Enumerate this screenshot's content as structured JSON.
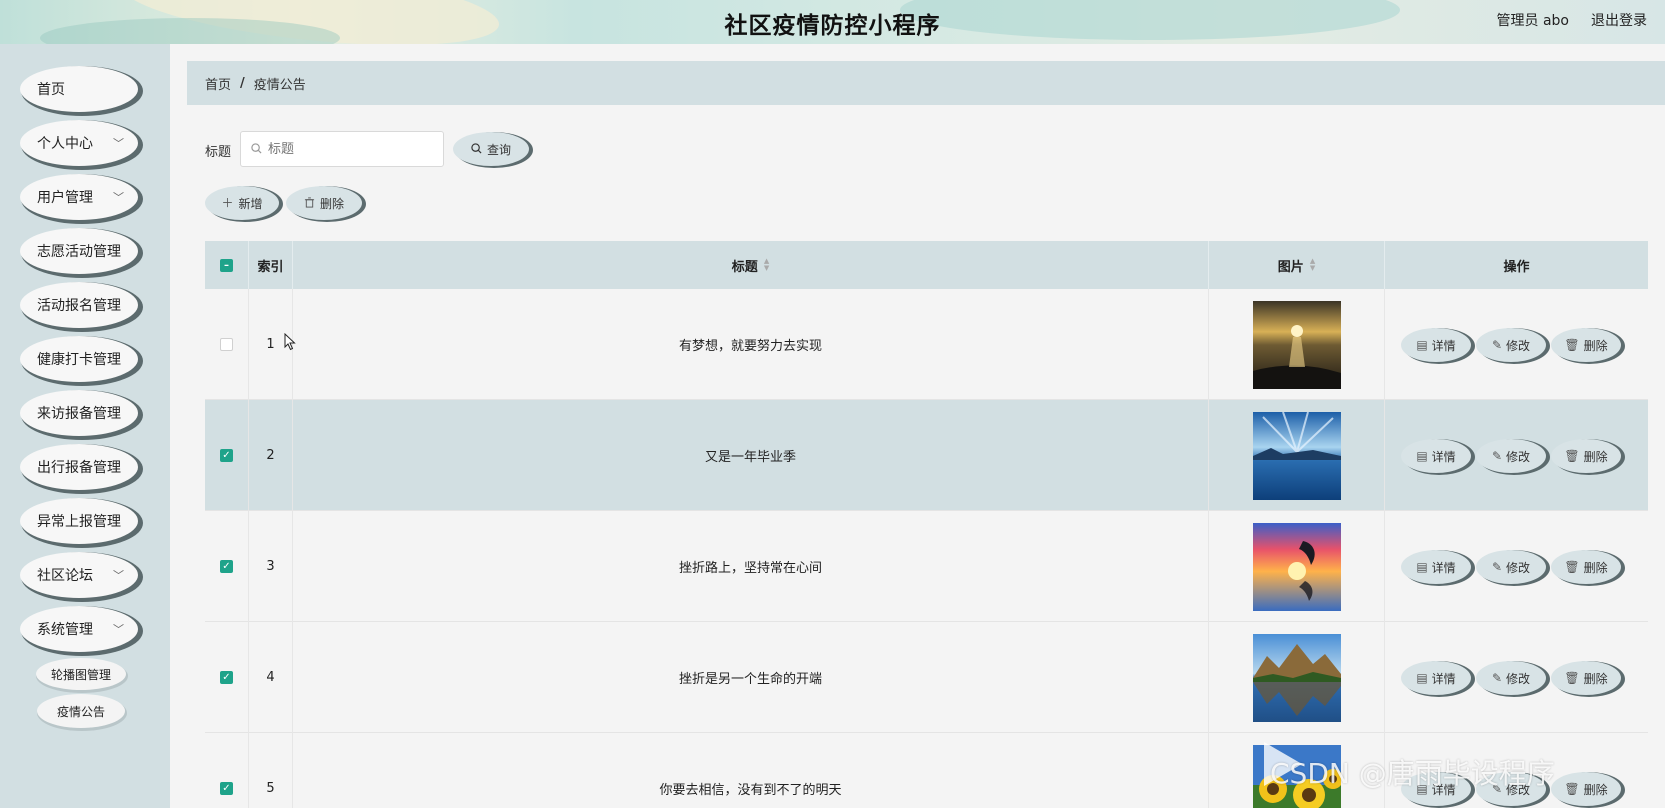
{
  "header": {
    "title": "社区疫情防控小程序",
    "user": "管理员 abo",
    "logout": "退出登录"
  },
  "sidebar": {
    "items": [
      {
        "label": "首页",
        "chevron": false
      },
      {
        "label": "个人中心",
        "chevron": true
      },
      {
        "label": "用户管理",
        "chevron": true
      },
      {
        "label": "志愿活动管理",
        "chevron": false
      },
      {
        "label": "活动报名管理",
        "chevron": false
      },
      {
        "label": "健康打卡管理",
        "chevron": false
      },
      {
        "label": "来访报备管理",
        "chevron": false
      },
      {
        "label": "出行报备管理",
        "chevron": false
      },
      {
        "label": "异常上报管理",
        "chevron": false
      },
      {
        "label": "社区论坛",
        "chevron": true
      },
      {
        "label": "系统管理",
        "chevron": true
      }
    ],
    "subitems": [
      "轮播图管理",
      "疫情公告"
    ]
  },
  "breadcrumb": {
    "home": "首页",
    "sep": "/",
    "current": "疫情公告"
  },
  "search": {
    "label": "标题",
    "placeholder": "标题",
    "button": "查询"
  },
  "actions": {
    "add": "新增",
    "delete": "删除"
  },
  "table": {
    "headers": {
      "index": "索引",
      "title": "标题",
      "image": "图片",
      "ops": "操作"
    },
    "ops": {
      "detail": "详情",
      "edit": "修改",
      "delete": "删除"
    },
    "rows": [
      {
        "index": "1",
        "title": "有梦想，就要努力去实现",
        "checked": false,
        "image": "sunset-beach"
      },
      {
        "index": "2",
        "title": "又是一年毕业季",
        "checked": true,
        "image": "blue-lake"
      },
      {
        "index": "3",
        "title": "挫折路上，坚持常在心间",
        "checked": true,
        "image": "dolphin-sunset"
      },
      {
        "index": "4",
        "title": "挫折是另一个生命的开端",
        "checked": true,
        "image": "mountain-lake"
      },
      {
        "index": "5",
        "title": "你要去相信，没有到不了的明天",
        "checked": true,
        "image": "sunflowers"
      }
    ]
  },
  "watermark": "CSDN @唐雨毕设程序",
  "colors": {
    "accent": "#1ea38a",
    "panel": "#d2dfe2",
    "pill_shadow": "#5c6b6e"
  }
}
